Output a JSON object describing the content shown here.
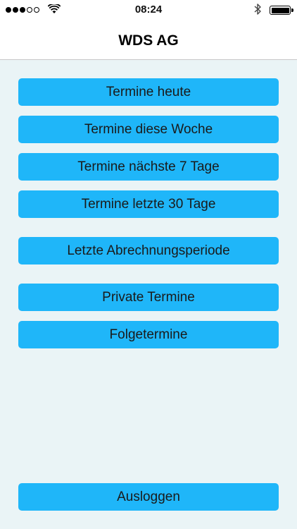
{
  "status_bar": {
    "time": "08:24",
    "signal_bars_filled": 3,
    "signal_bars_total": 5,
    "icons": [
      "wifi-icon",
      "bluetooth-icon",
      "battery-icon"
    ],
    "battery_level": 1.0
  },
  "nav": {
    "title": "WDS AG"
  },
  "menu": {
    "today": "Termine heute",
    "this_week": "Termine diese Woche",
    "next_7_days": "Termine nächste 7 Tage",
    "last_30_days": "Termine letzte 30 Tage",
    "last_billing_period": "Letzte Abrechnungsperiode",
    "private": "Private Termine",
    "follow_up": "Folgetermine"
  },
  "logout_label": "Ausloggen",
  "colors": {
    "button": "#1fb6f9",
    "background": "#eaf4f6",
    "nav_background": "#ffffff"
  }
}
